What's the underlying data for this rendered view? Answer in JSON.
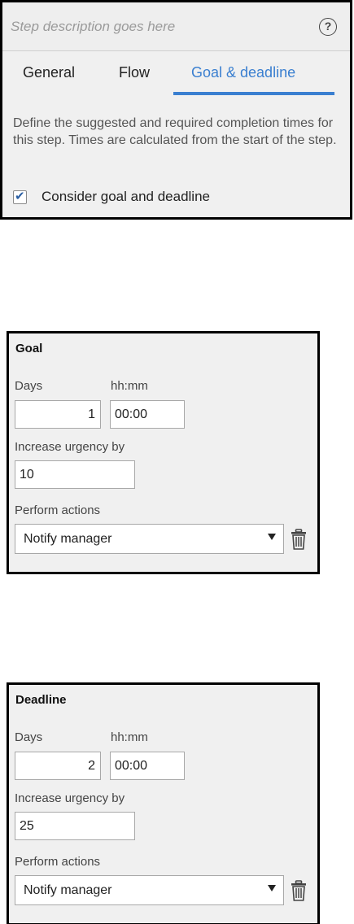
{
  "step": {
    "description_placeholder": "Step description goes here",
    "help_icon": "?",
    "tabs": [
      {
        "label": "General",
        "active": false
      },
      {
        "label": "Flow",
        "active": false
      },
      {
        "label": "Goal & deadline",
        "active": true
      }
    ],
    "accent_color": "#3a7fd0",
    "description": "Define the suggested and required completion times for this step. Times are calculated from the start of the step.",
    "consider_label": "Consider goal and deadline",
    "consider_checked": true
  },
  "goal": {
    "title": "Goal",
    "days_label": "Days",
    "days_value": "1",
    "time_label": "hh:mm",
    "time_value": "00:00",
    "urgency_label": "Increase urgency by",
    "urgency_value": "10",
    "actions_label": "Perform actions",
    "action_selected": "Notify manager"
  },
  "deadline": {
    "title": "Deadline",
    "days_label": "Days",
    "days_value": "2",
    "time_label": "hh:mm",
    "time_value": "00:00",
    "urgency_label": "Increase urgency by",
    "urgency_value": "25",
    "actions_label": "Perform actions",
    "action_selected": "Notify manager"
  }
}
